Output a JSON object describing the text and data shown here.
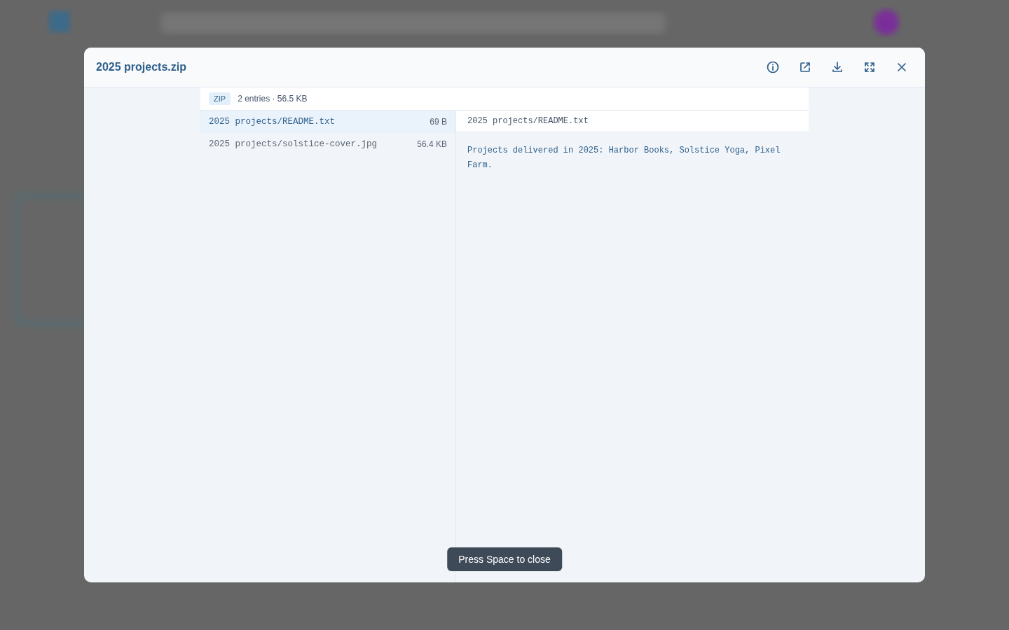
{
  "dialog": {
    "title": "2025 projects.zip",
    "actions": [
      {
        "kind": "info"
      },
      {
        "kind": "open-external"
      },
      {
        "kind": "download"
      },
      {
        "kind": "fullscreen"
      },
      {
        "kind": "close"
      }
    ]
  },
  "archive": {
    "badge": "ZIP",
    "summary": "2 entries · 56.5 KB",
    "entries": [
      {
        "name": "2025 projects/README.txt",
        "size": "69 B",
        "selected": true
      },
      {
        "name": "2025 projects/solstice-cover.jpg",
        "size": "56.4 KB",
        "selected": false
      }
    ]
  },
  "preview": {
    "path": "2025 projects/README.txt",
    "text": "Projects delivered in 2025: Harbor Books, Solstice Yoga, Pixel Farm."
  },
  "toast": "Press Space to close"
}
